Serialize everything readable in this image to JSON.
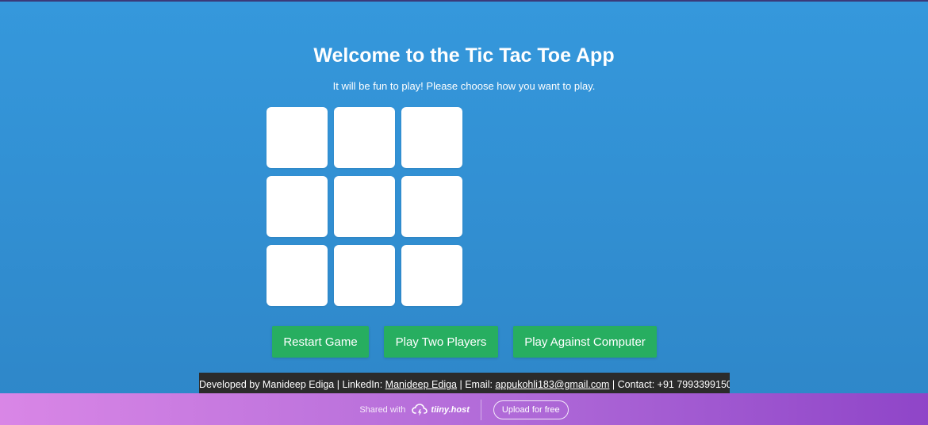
{
  "header": {
    "title": "Welcome to the Tic Tac Toe App",
    "subtitle": "It will be fun to play! Please choose how you want to play."
  },
  "board": {
    "cells": [
      "",
      "",
      "",
      "",
      "",
      "",
      "",
      "",
      ""
    ]
  },
  "controls": {
    "restart_label": "Restart Game",
    "two_players_label": "Play Two Players",
    "computer_label": "Play Against Computer",
    "button_color": "#27ae60"
  },
  "footer": {
    "developed_by": "Developed by Manideep Ediga | LinkedIn: ",
    "linkedin_label": "Manideep Ediga",
    "email_prefix": " | Email: ",
    "email": "appukohli183@gmail.com",
    "contact": " | Contact: +91 7993399150"
  },
  "share_bar": {
    "shared_with": "Shared with",
    "brand": "tiiny.host",
    "upload_label": "Upload for free"
  },
  "colors": {
    "background": "#3598dc",
    "cell": "#ffffff",
    "footer_bg": "#2b2b2b"
  }
}
